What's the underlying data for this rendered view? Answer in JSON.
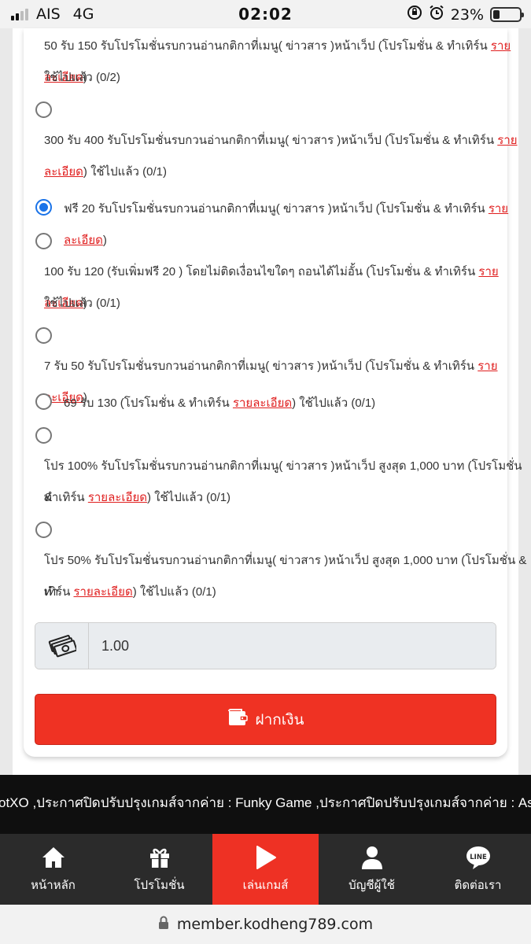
{
  "status_bar": {
    "carrier": "AIS",
    "network": "4G",
    "time": "02:02",
    "battery": "23%"
  },
  "promotions": [
    {
      "text": "50 รับ 150 รับโปรโมชั่นรบกวนอ่านกติกาที่เมนู( ข่าวสาร )หน้าเว็ป (โปรโมชั่น & ทำเทิร์น",
      "link": "รายละเอียด",
      "after": ")",
      "line2": "ใช้ไปแล้ว (0/2)"
    },
    {
      "text": "300 รับ 400 รับโปรโมชั่นรบกวนอ่านกติกาที่เมนู( ข่าวสาร )หน้าเว็ป (โปรโมชั่น & ทำเทิร์น",
      "link_part1": "ราย",
      "link_part2": "ละเอียด",
      "after": ") ใช้ไปแล้ว (0/1)"
    },
    {
      "text": "ฟรี 20 รับโปรโมชั่นรบกวนอ่านกติกาที่เมนู( ข่าวสาร )หน้าเว็ป (โปรโมชั่น & ทำเทิร์น",
      "link": "รายละเอียด",
      "after": ")",
      "selected": true
    },
    {
      "text": "100 รับ 120 (รับเพิ่มฟรี 20 ) โดยไม่ติดเงื่อนไขใดๆ ถอนได้ไม่อั้น (โปรโมชั่น & ทำเทิร์น",
      "link": "รายละเอียด",
      "after": ")",
      "line2": "ใช้ไปแล้ว (0/1)"
    },
    {
      "text": "7 รับ 50 รับโปรโมชั่นรบกวนอ่านกติกาที่เมนู( ข่าวสาร )หน้าเว็ป (โปรโมชั่น & ทำเทิร์น",
      "link": "รายละเอียด",
      "after": ")"
    },
    {
      "text": "69 รับ 130 (โปรโมชั่น & ทำเทิร์น",
      "link": "รายละเอียด",
      "after": ") ใช้ไปแล้ว (0/1)"
    },
    {
      "text": "โปร 100% รับโปรโมชั่นรบกวนอ่านกติกาที่เมนู( ข่าวสาร )หน้าเว็ป สูงสุด 1,000 บาท (โปรโมชั่น &",
      "line2_pre": "ทำเทิร์น",
      "link": "รายละเอียด",
      "after": ") ใช้ไปแล้ว (0/1)"
    },
    {
      "text": "โปร 50% รับโปรโมชั่นรบกวนอ่านกติกาที่เมนู( ข่าวสาร )หน้าเว็ป สูงสุด 1,000 บาท (โปรโมชั่น & ทำ",
      "line2_pre": "เทิร์น",
      "link": "รายละเอียด",
      "after": ") ใช้ไปแล้ว (0/1)"
    }
  ],
  "amount": {
    "value": "1.00",
    "icon": "money-icon"
  },
  "deposit_button": {
    "label": "ฝากเงิน",
    "icon": "wallet-icon",
    "color": "#ef3223"
  },
  "ticker": "otXO ,ประกาศปิดปรับปรุงเกมส์จากค่าย : Funky Game ,ประกาศปิดปรับปรุงเกมส์จากค่าย : Ask",
  "bottom_nav": [
    {
      "label": "หน้าหลัก",
      "icon": "home-icon"
    },
    {
      "label": "โปรโมชั่น",
      "icon": "gift-icon"
    },
    {
      "label": "เล่นเกมส์",
      "icon": "play-icon",
      "active": true
    },
    {
      "label": "บัญชีผู้ใช้",
      "icon": "user-icon"
    },
    {
      "label": "ติดต่อเรา",
      "icon": "line-icon"
    }
  ],
  "url_bar": {
    "url": "member.kodheng789.com",
    "icon": "lock-icon"
  }
}
